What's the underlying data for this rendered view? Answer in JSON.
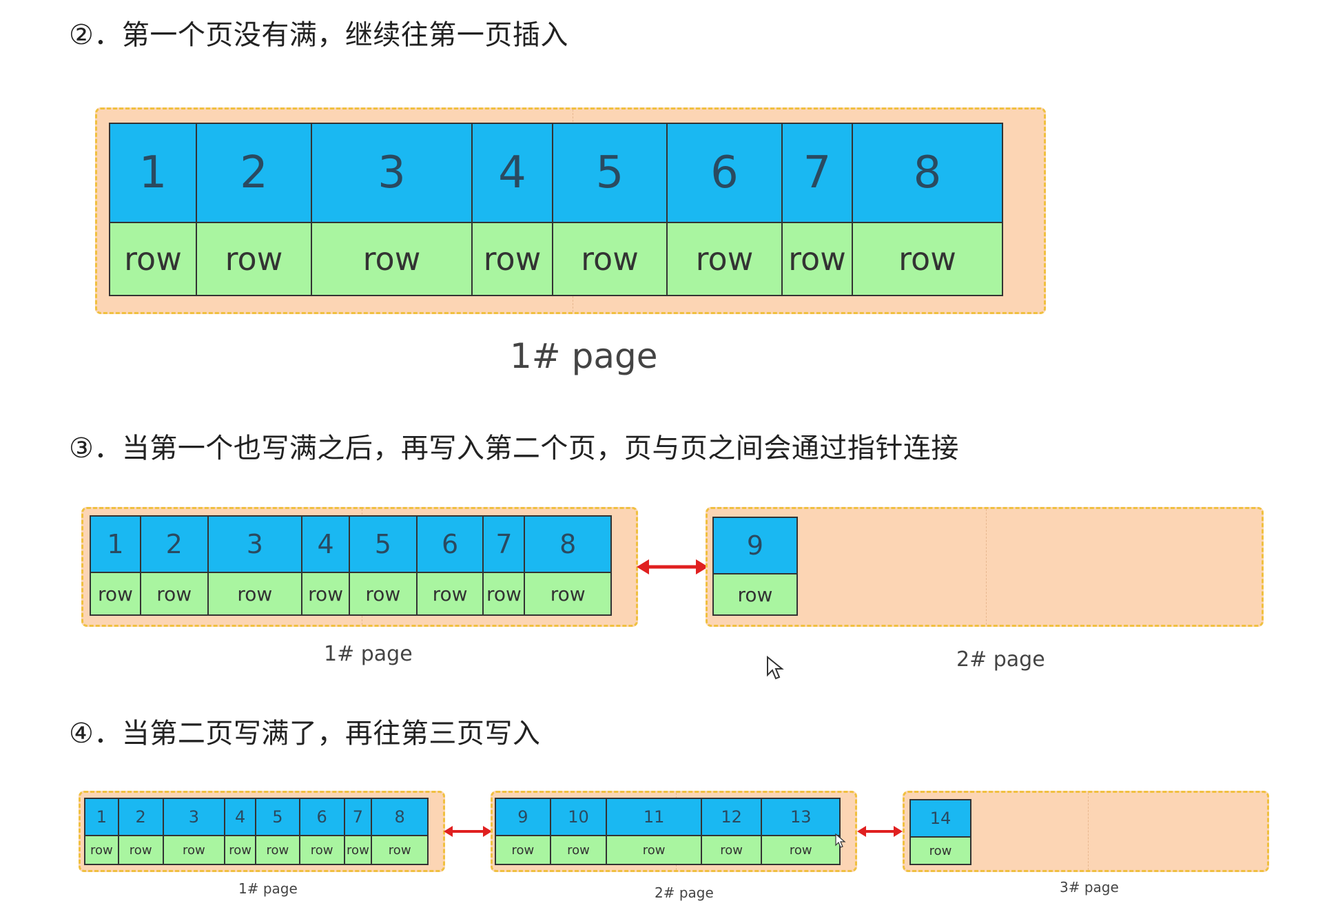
{
  "headings": {
    "step2": "②．第一个页没有满，继续往第一页插入",
    "step3": "③．当第一个也写满之后，再写入第二个页，页与页之间会通过指针连接",
    "step4": "④．当第二页写满了，再往第三页写入"
  },
  "cell_row_label": "row",
  "diagram1": {
    "page_label": "1#  page",
    "cells": [
      "1",
      "2",
      "3",
      "4",
      "5",
      "6",
      "7",
      "8"
    ]
  },
  "diagram2": {
    "page1_label": "1#  page",
    "page1_cells": [
      "1",
      "2",
      "3",
      "4",
      "5",
      "6",
      "7",
      "8"
    ],
    "page2_label": "2#  page",
    "page2_cells": [
      "9"
    ]
  },
  "diagram3": {
    "page1_label": "1#  page",
    "page1_cells": [
      "1",
      "2",
      "3",
      "4",
      "5",
      "6",
      "7",
      "8"
    ],
    "page2_label": "2#  page",
    "page2_cells": [
      "9",
      "10",
      "11",
      "12",
      "13"
    ],
    "page3_label": "3#  page",
    "page3_cells": [
      "14"
    ]
  },
  "colors": {
    "page_fill": "#fcd5b4",
    "page_border": "#f0c040",
    "number_cell": "#1ab8f2",
    "row_cell": "#a9f5a0",
    "pointer_arrow": "#e02020"
  },
  "icons": {
    "pointer": "double-arrow-icon",
    "cursor": "mouse-cursor-icon"
  }
}
